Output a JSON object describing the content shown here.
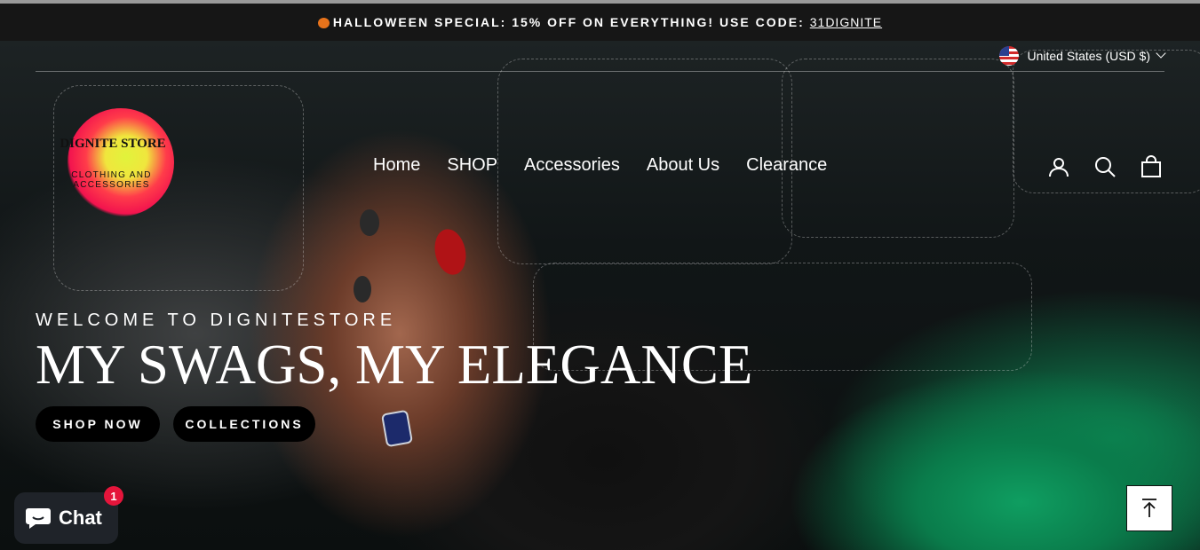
{
  "announcement": {
    "text": "HALLOWEEN SPECIAL: 15% OFF ON EVERYTHING! USE CODE:",
    "code": "31DIGNITE",
    "icon": "pumpkin-icon"
  },
  "currency": {
    "label": "United States (USD $)",
    "flag": "us-flag-icon"
  },
  "logo": {
    "name": "DIGNITE STORE",
    "tagline": "CLOTHING AND ACCESSORIES"
  },
  "nav": {
    "items": [
      {
        "label": "Home"
      },
      {
        "label": "SHOP"
      },
      {
        "label": "Accessories"
      },
      {
        "label": "About Us"
      },
      {
        "label": "Clearance"
      }
    ]
  },
  "header_icons": [
    "account-icon",
    "search-icon",
    "cart-icon"
  ],
  "hero": {
    "kicker": "WELCOME TO DIGNITESTORE",
    "headline": "MY SWAGS, MY ELEGANCE",
    "primary_button": "SHOP NOW",
    "secondary_button": "COLLECTIONS"
  },
  "chat": {
    "label": "Chat",
    "badge": "1"
  },
  "colors": {
    "announcement_bg": "#161616",
    "button_bg": "#000000",
    "badge": "#e5153b",
    "chat_bg": "#1f2329"
  }
}
